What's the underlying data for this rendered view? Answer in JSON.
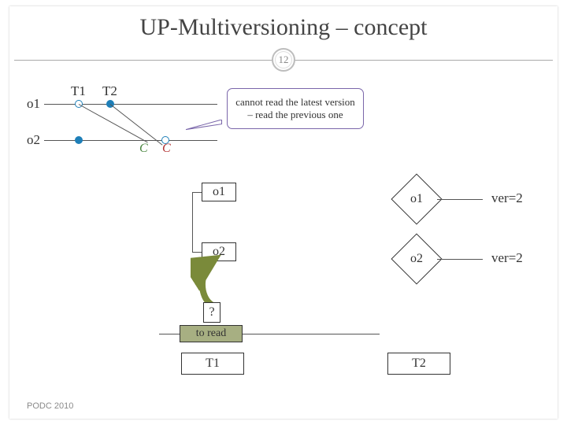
{
  "title": "UP-Multiversioning – concept",
  "slide_number": "12",
  "timeline": {
    "rows": [
      "o1",
      "o2"
    ],
    "transactions": [
      "T1",
      "T2"
    ],
    "commit_green": "C",
    "commit_red": "C"
  },
  "callout": "cannot read the latest version – read the previous one",
  "objects": {
    "o1_box": "o1",
    "o2_box": "o2",
    "o1_diamond": "o1",
    "o2_diamond": "o2",
    "ver1": "ver=2",
    "ver2": "ver=2",
    "question": "?",
    "to_read": "to read",
    "tx1_box": "T1",
    "tx2_box": "T2"
  },
  "footer": "PODC 2010",
  "chart_data": {
    "type": "diagram",
    "description": "Multiversion concurrency control concept: two objects o1, o2 on horizontal timelines; transactions T1 and T2 mark points; two commit points (C) on o2's line; a callout indicates a reader cannot read the latest version and must read the previous one; below, version boxes show o1 and o2 each at ver=2, with a question-mark indicating a read conflict, and T1 (to read) vs T2.",
    "objects": [
      "o1",
      "o2"
    ],
    "transactions": [
      "T1",
      "T2"
    ],
    "versions": {
      "o1": 2,
      "o2": 2
    },
    "commit_markers_on_o2": 2
  }
}
